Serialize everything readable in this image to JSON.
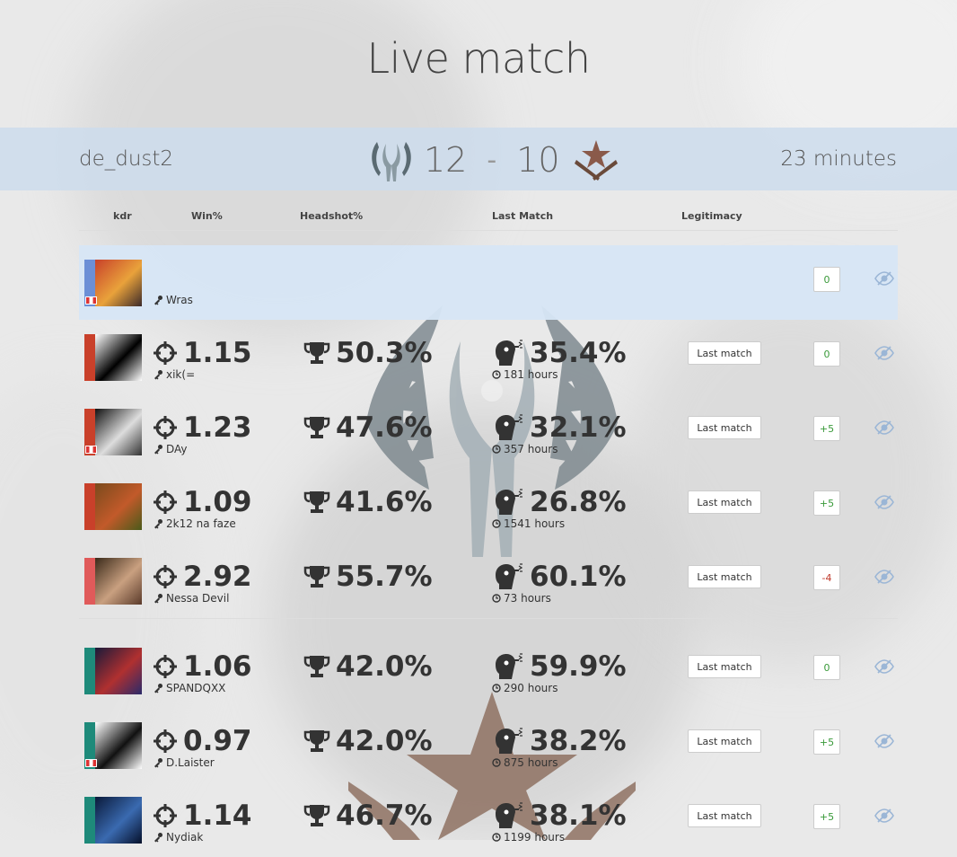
{
  "page": {
    "title": "Live match"
  },
  "match": {
    "map": "de_dust2",
    "ct_score": "12",
    "separator": "-",
    "t_score": "10",
    "duration": "23 minutes"
  },
  "columns": {
    "kdr": "kdr",
    "win": "Win%",
    "headshot": "Headshot%",
    "last_match": "Last Match",
    "legitimacy": "Legitimacy"
  },
  "button_label": "Last match",
  "players": [
    {
      "name": "Wras",
      "kdr": "",
      "win": "",
      "hs": "",
      "hours": "",
      "legit": "0",
      "legit_class": "pos",
      "team_color": "#6c8fd6",
      "flag": true,
      "has_stats": false,
      "avatar_colors": [
        "#c8412a",
        "#e9a23b",
        "#3b2a2a"
      ]
    },
    {
      "name": "xik(=",
      "kdr": "1.15",
      "win": "50.3%",
      "hs": "35.4%",
      "hours": "181 hours",
      "legit": "0",
      "legit_class": "pos",
      "team_color": "#c9402a",
      "flag": false,
      "has_stats": true,
      "avatar_colors": [
        "#ffffff",
        "#000000",
        "#ffffff"
      ]
    },
    {
      "name": "DAy",
      "kdr": "1.23",
      "win": "47.6%",
      "hs": "32.1%",
      "hours": "357 hours",
      "legit": "+5",
      "legit_class": "pos",
      "team_color": "#c9402a",
      "flag": true,
      "has_stats": true,
      "avatar_colors": [
        "#111111",
        "#dddddd",
        "#333333"
      ]
    },
    {
      "name": "2k12 na faze",
      "kdr": "1.09",
      "win": "41.6%",
      "hs": "26.8%",
      "hours": "1541 hours",
      "legit": "+5",
      "legit_class": "pos",
      "team_color": "#c9402a",
      "flag": false,
      "has_stats": true,
      "avatar_colors": [
        "#7a4a1c",
        "#c25a2a",
        "#4a5a1a"
      ]
    },
    {
      "name": "Nessa Devil",
      "kdr": "2.92",
      "win": "55.7%",
      "hs": "60.1%",
      "hours": "73 hours",
      "legit": "-4",
      "legit_class": "neg",
      "team_color": "#e05a5a",
      "flag": false,
      "has_stats": true,
      "avatar_colors": [
        "#3a2a1a",
        "#c9a080",
        "#5a3a2a"
      ]
    },
    {
      "name": "SPANDQXX",
      "kdr": "1.06",
      "win": "42.0%",
      "hs": "59.9%",
      "hours": "290 hours",
      "legit": "0",
      "legit_class": "pos",
      "team_color": "#1e8a7a",
      "flag": false,
      "has_stats": true,
      "avatar_colors": [
        "#1a1a3a",
        "#b03030",
        "#2a2a6a"
      ]
    },
    {
      "name": "D.Laister",
      "kdr": "0.97",
      "win": "42.0%",
      "hs": "38.2%",
      "hours": "875 hours",
      "legit": "+5",
      "legit_class": "pos",
      "team_color": "#1e8a7a",
      "flag": true,
      "has_stats": true,
      "avatar_colors": [
        "#ffffff",
        "#111111",
        "#ffffff"
      ]
    },
    {
      "name": "Nydiak",
      "kdr": "1.14",
      "win": "46.7%",
      "hs": "38.1%",
      "hours": "1199 hours",
      "legit": "+5",
      "legit_class": "pos",
      "team_color": "#1e8a7a",
      "flag": false,
      "has_stats": true,
      "avatar_colors": [
        "#0a1a3a",
        "#3a6ab0",
        "#05102a"
      ]
    }
  ],
  "icons": {
    "kdr": "crosshair-icon",
    "win": "trophy-icon",
    "headshot": "headshot-icon",
    "hours": "clock-icon",
    "name": "steam-key-icon",
    "spectate": "eye-slash-icon",
    "ct": "counter-terrorist-logo-icon",
    "t": "terrorist-logo-icon"
  }
}
